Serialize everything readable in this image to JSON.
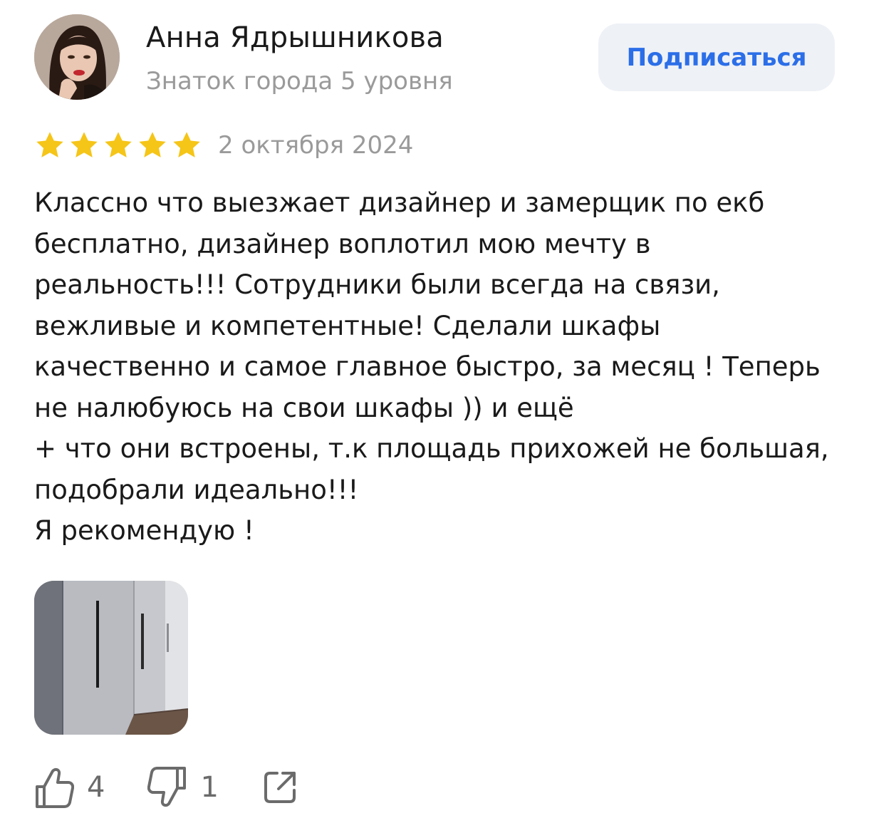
{
  "author": {
    "name": "Анна Ядрышникова",
    "level": "Знаток города 5 уровня",
    "avatar_icon": "user-avatar-photo"
  },
  "subscribe_label": "Подписаться",
  "review": {
    "rating": 5,
    "rating_max": 5,
    "date": "2 октября 2024",
    "text": "Классно что выезжает дизайнер и замерщик по екб бесплатно, дизайнер воплотил мою мечту в реальность!!! Сотрудники были всегда на связи, вежливые и компетентные!  Сделали шкафы качественно и самое главное быстро,  за месяц ! Теперь не налюбуюсь на свои шкафы )) и ещё\n+ что они встроены, т.к площадь прихожей не большая,  подобрали идеально!!!\nЯ рекомендую !",
    "photos": [
      {
        "icon": "wardrobe-photo"
      }
    ]
  },
  "actions": {
    "likes": "4",
    "dislikes": "1",
    "like_icon": "thumbs-up-icon",
    "dislike_icon": "thumbs-down-icon",
    "share_icon": "share-icon"
  },
  "colors": {
    "accent": "#2b6ee8",
    "star": "#f5c518",
    "muted_text": "#9a9a9a",
    "button_bg": "#eef1f6"
  }
}
